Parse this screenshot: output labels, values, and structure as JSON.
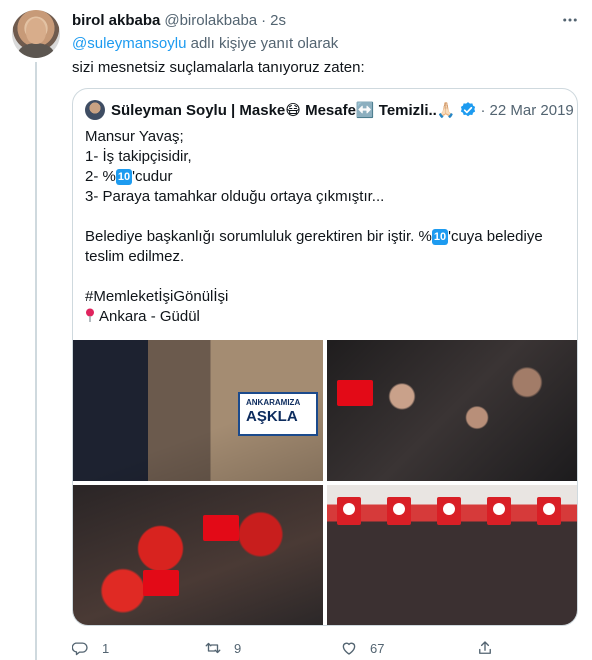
{
  "tweet": {
    "author_name": "birol akbaba",
    "author_handle": "@birolakbaba",
    "separator": "·",
    "time": "2s",
    "reply_mention": "@suleymansoylu",
    "reply_suffix": "adlı kişiye yanıt olarak",
    "text": "sizi mesnetsiz suçlamalarla tanıyoruz zaten:"
  },
  "quote": {
    "name": "Süleyman Soylu | Maske😷 Mesafe↔️ Temizli..🙏🏻",
    "handle_date": "22 Mar 2019",
    "lines": {
      "l1": "Mansur Yavaş;",
      "l2": "1- İş takipçisidir,",
      "l3a": "2- %",
      "l3k": "10",
      "l3b": "'cudur",
      "l4": "3- Paraya tamahkar olduğu ortaya çıkmıştır...",
      "l5a": "Belediye başkanlığı sorumluluk gerektiren bir iştir. %",
      "l5k": "10",
      "l5b": "'cuya belediye teslim edilmez.",
      "l6": "#MemleketİşiGönülİşi",
      "l7": "Ankara - Güdül"
    },
    "photos": {
      "banner_top": "ANKARAMIZA",
      "banner_main": "AŞKLA"
    }
  },
  "actions": {
    "replies": "1",
    "retweets": "9",
    "likes": "67"
  },
  "colors": {
    "accent": "#1d9bf0",
    "secondary_text": "#536471",
    "border": "#cfd9de"
  }
}
